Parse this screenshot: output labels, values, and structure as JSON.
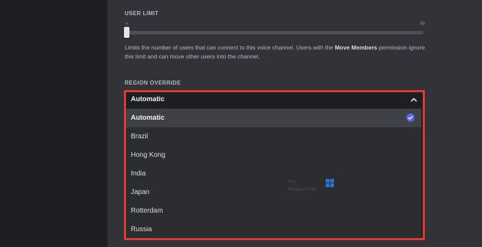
{
  "user_limit": {
    "label": "USER LIMIT",
    "tick_min": "∞",
    "tick_max": "99",
    "slider_value": 0,
    "description_pre": "Limits the number of users that can connect to this voice channel. Users with the ",
    "description_bold": "Move Members",
    "description_post": " permission ignore this limit and can move other users into the channel."
  },
  "region_override": {
    "label": "REGION OVERRIDE",
    "selected_value": "Automatic",
    "options": [
      "Automatic",
      "Brazil",
      "Hong Kong",
      "India",
      "Japan",
      "Rotterdam",
      "Russia"
    ],
    "selected_index": 0
  },
  "icons": {
    "chevron": "chevron-up-icon",
    "check": "check-circle-icon"
  },
  "watermark": {
    "line1": "The",
    "line2": "WindowsClub"
  },
  "colors": {
    "accent": "#5865f2",
    "highlight_border": "#e53935",
    "panel_bg": "#313338"
  }
}
